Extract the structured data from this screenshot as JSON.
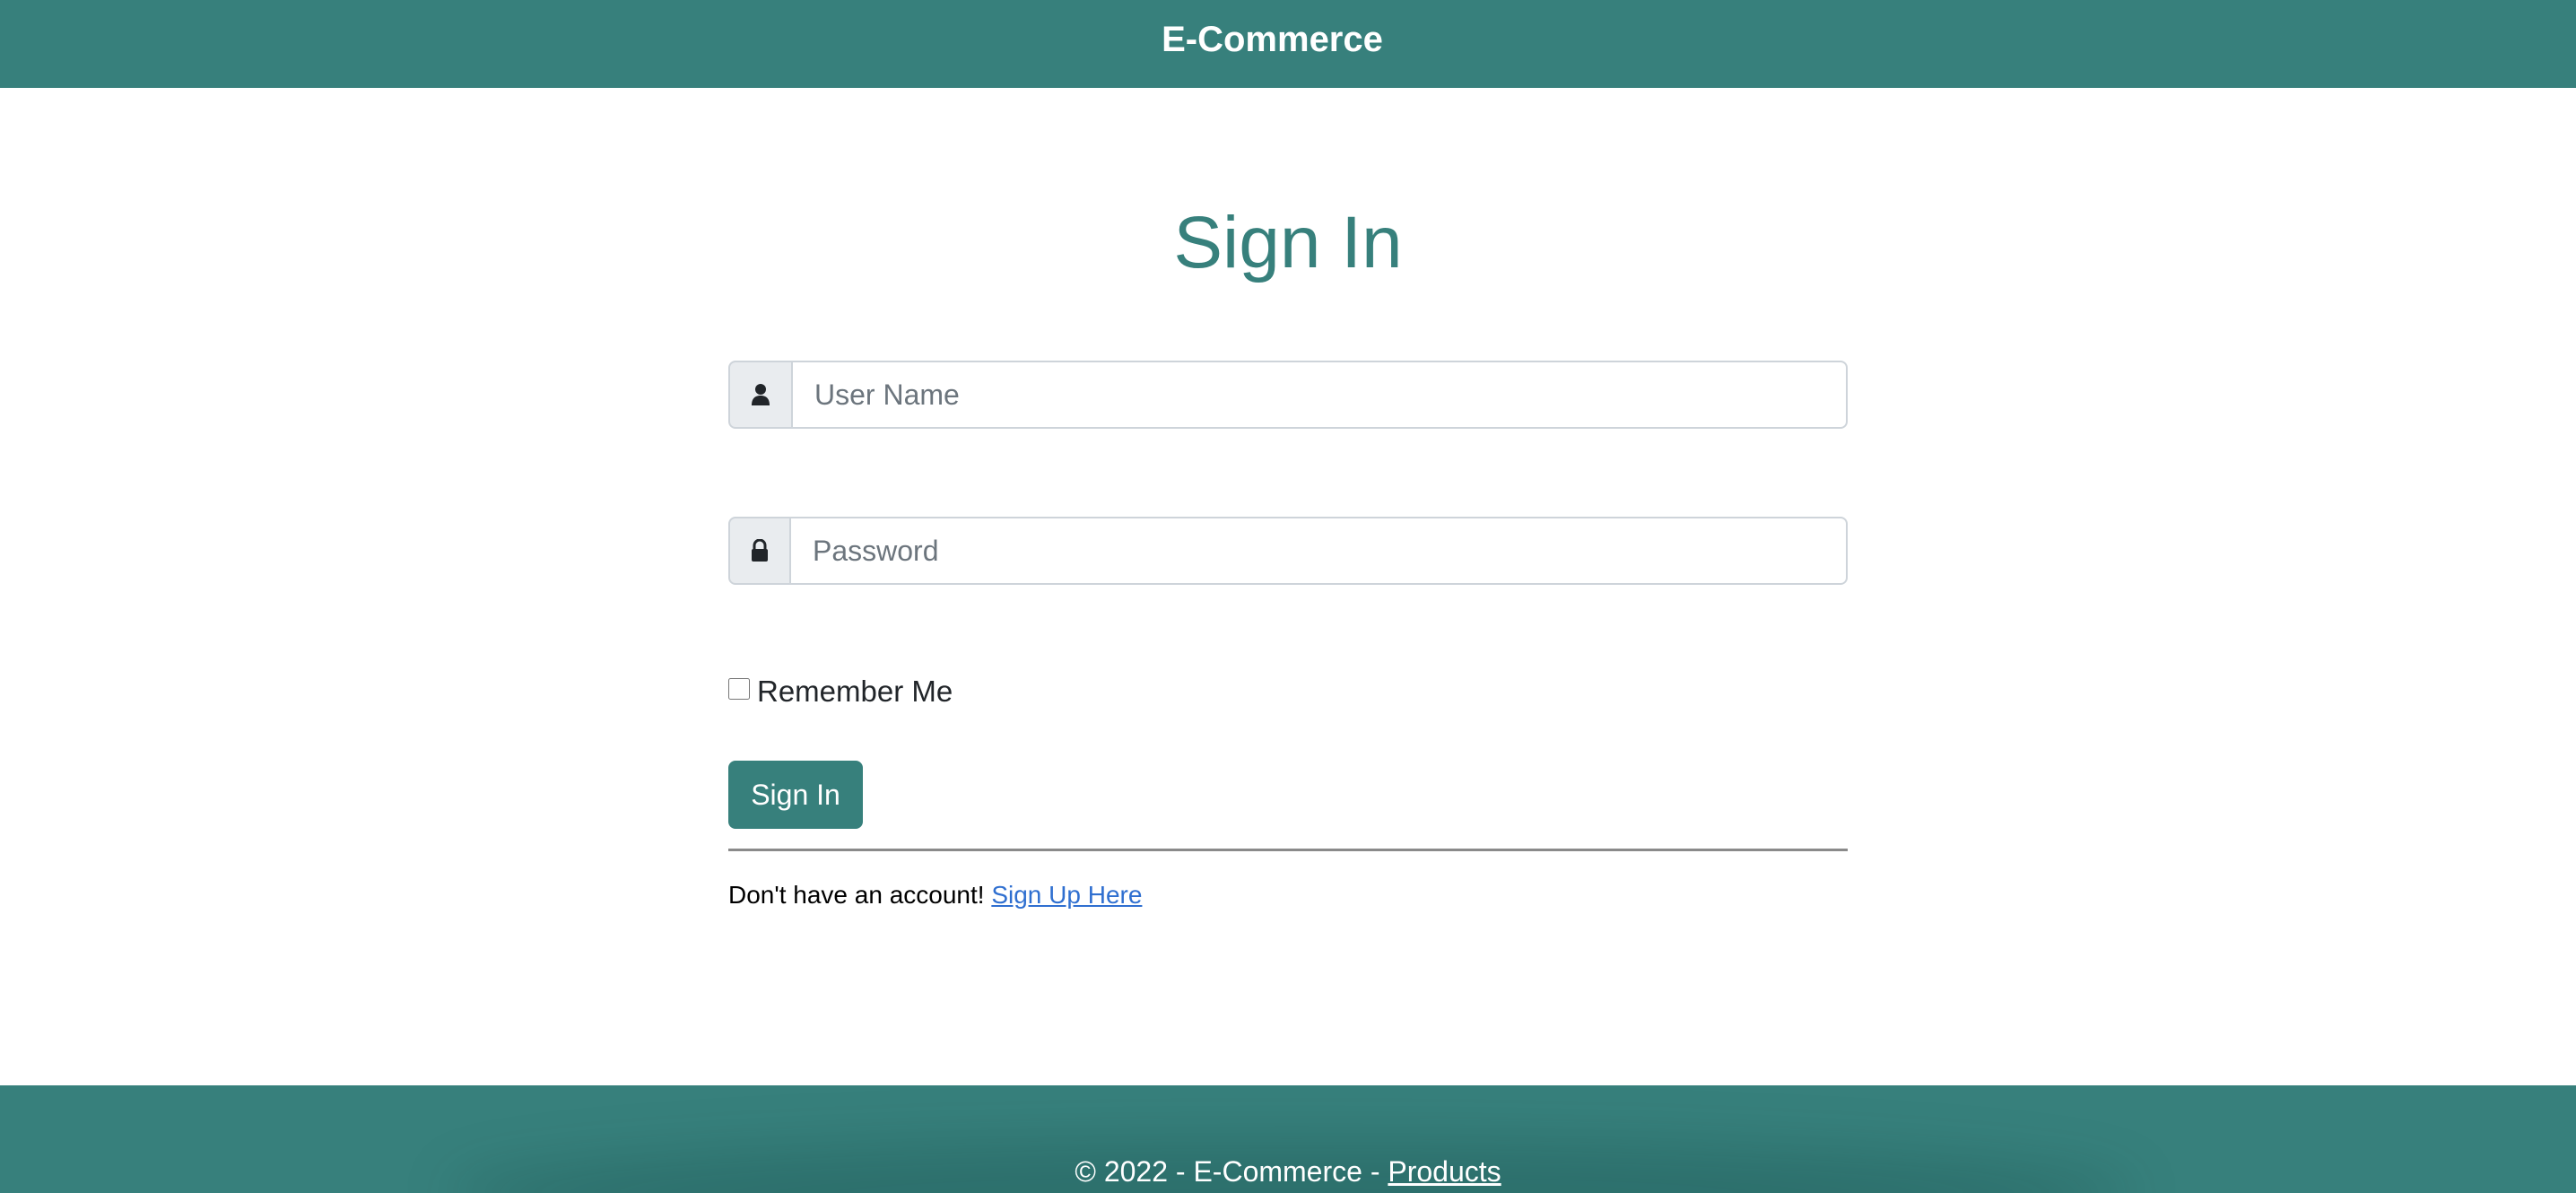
{
  "header": {
    "brand": "E-Commerce"
  },
  "form": {
    "title": "Sign In",
    "username": {
      "placeholder": "User Name",
      "value": "",
      "icon": "user-icon"
    },
    "password": {
      "placeholder": "Password",
      "value": "",
      "icon": "lock-icon"
    },
    "remember_label": "Remember Me",
    "remember_checked": false,
    "submit_label": "Sign In",
    "signup_prompt": "Don't have an account!",
    "signup_link": "Sign Up Here"
  },
  "footer": {
    "copyright": "© 2022 - E-Commerce -",
    "link": "Products"
  },
  "colors": {
    "accent": "#37807c",
    "link": "#2f6fd0",
    "addon_bg": "#e9ecef",
    "border": "#ced4da"
  }
}
